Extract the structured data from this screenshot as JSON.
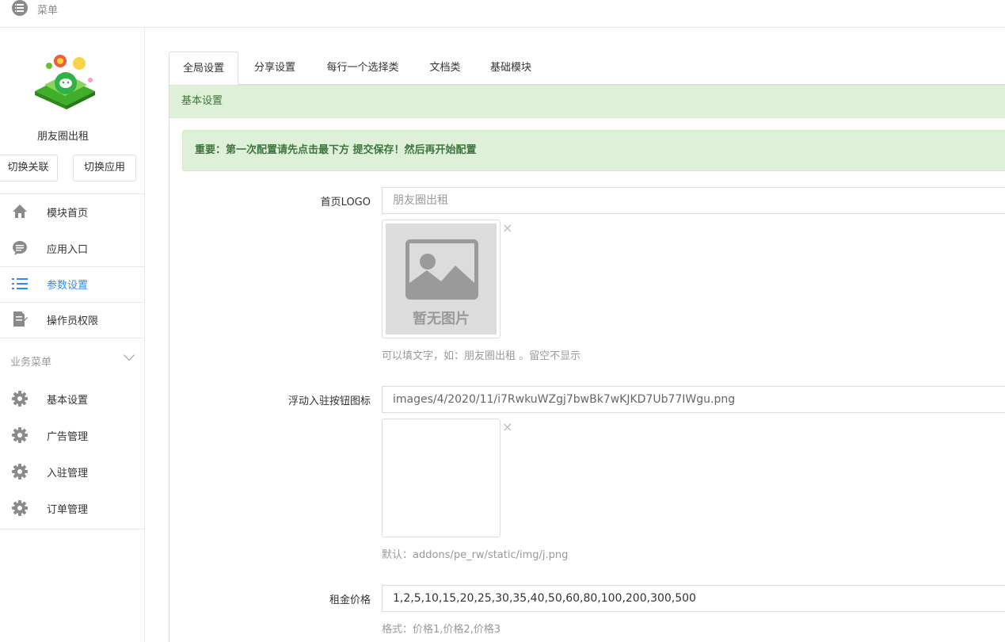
{
  "topbar": {
    "menu_label": "菜单",
    "menu_icon": "list-icon"
  },
  "sidebar": {
    "app_name": "朋友圈出租",
    "switch_related": "切换关联",
    "switch_app": "切换应用",
    "main_items": [
      {
        "label": "模块首页",
        "icon": "home-icon"
      },
      {
        "label": "应用入口",
        "icon": "chat-bubble-icon"
      },
      {
        "label": "参数设置",
        "icon": "list-settings-icon",
        "active": true
      },
      {
        "label": "操作员权限",
        "icon": "document-edit-icon"
      }
    ],
    "section_title": "业务菜单",
    "business_items": [
      {
        "label": "基本设置",
        "icon": "gear-icon"
      },
      {
        "label": "广告管理",
        "icon": "gear-icon"
      },
      {
        "label": "入驻管理",
        "icon": "gear-icon"
      },
      {
        "label": "订单管理",
        "icon": "gear-icon"
      }
    ]
  },
  "tabs": [
    "全局设置",
    "分享设置",
    "每行一个选择类",
    "文档类",
    "基础模块"
  ],
  "panel": {
    "heading": "基本设置",
    "alert": "重要：第一次配置请先点击最下方 提交保存！然后再开始配置"
  },
  "form": {
    "logo": {
      "label": "首页LOGO",
      "placeholder": "朋友圈出租",
      "no_image_text": "暂无图片",
      "help": "可以填文字，如：朋友圈出租 。留空不显示"
    },
    "float_icon": {
      "label": "浮动入驻按钮图标",
      "value": "images/4/2020/11/i7RwkuWZgj7bwBk7wKJKD7Ub77IWgu.png",
      "help": "默认：addons/pe_rw/static/img/j.png"
    },
    "rent_price": {
      "label": "租金价格",
      "value": "1,2,5,10,15,20,25,30,35,40,50,60,80,100,200,300,500",
      "help": "格式：价格1,价格2,价格3"
    },
    "remove_symbol": "×"
  },
  "colors": {
    "accent": "#2d8cf0",
    "success_bg": "#dff0d8",
    "success_text": "#3c763d"
  }
}
